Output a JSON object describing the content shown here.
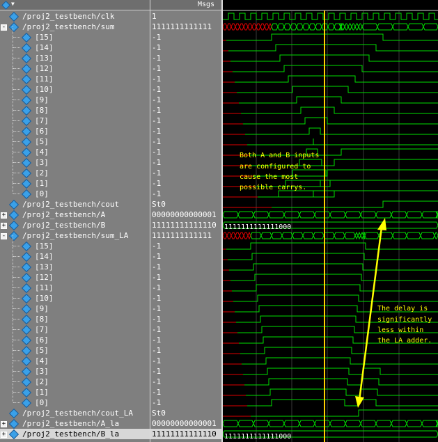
{
  "header": {
    "values_title": "Msgs"
  },
  "signals": [
    {
      "name": "/proj2_testbench/clk",
      "value": "1",
      "level": 0,
      "expander": ""
    },
    {
      "name": "/proj2_testbench/sum",
      "value": "1111111111111",
      "level": 0,
      "expander": "-"
    },
    {
      "name": "[15]",
      "value": "-1",
      "level": 1,
      "expander": ""
    },
    {
      "name": "[14]",
      "value": "-1",
      "level": 1,
      "expander": ""
    },
    {
      "name": "[13]",
      "value": "-1",
      "level": 1,
      "expander": ""
    },
    {
      "name": "[12]",
      "value": "-1",
      "level": 1,
      "expander": ""
    },
    {
      "name": "[11]",
      "value": "-1",
      "level": 1,
      "expander": ""
    },
    {
      "name": "[10]",
      "value": "-1",
      "level": 1,
      "expander": ""
    },
    {
      "name": "[9]",
      "value": "-1",
      "level": 1,
      "expander": ""
    },
    {
      "name": "[8]",
      "value": "-1",
      "level": 1,
      "expander": ""
    },
    {
      "name": "[7]",
      "value": "-1",
      "level": 1,
      "expander": ""
    },
    {
      "name": "[6]",
      "value": "-1",
      "level": 1,
      "expander": ""
    },
    {
      "name": "[5]",
      "value": "-1",
      "level": 1,
      "expander": ""
    },
    {
      "name": "[4]",
      "value": "-1",
      "level": 1,
      "expander": ""
    },
    {
      "name": "[3]",
      "value": "-1",
      "level": 1,
      "expander": ""
    },
    {
      "name": "[2]",
      "value": "-1",
      "level": 1,
      "expander": ""
    },
    {
      "name": "[1]",
      "value": "-1",
      "level": 1,
      "expander": ""
    },
    {
      "name": "[0]",
      "value": "-1",
      "level": 1,
      "expander": ""
    },
    {
      "name": "/proj2_testbench/cout",
      "value": "St0",
      "level": 0,
      "expander": ""
    },
    {
      "name": "/proj2_testbench/A",
      "value": "00000000000001",
      "level": 0,
      "expander": "+"
    },
    {
      "name": "/proj2_testbench/B",
      "value": "11111111111110",
      "level": 0,
      "expander": "+"
    },
    {
      "name": "/proj2_testbench/sum_LA",
      "value": "1111111111111",
      "level": 0,
      "expander": "-"
    },
    {
      "name": "[15]",
      "value": "-1",
      "level": 1,
      "expander": ""
    },
    {
      "name": "[14]",
      "value": "-1",
      "level": 1,
      "expander": ""
    },
    {
      "name": "[13]",
      "value": "-1",
      "level": 1,
      "expander": ""
    },
    {
      "name": "[12]",
      "value": "-1",
      "level": 1,
      "expander": ""
    },
    {
      "name": "[11]",
      "value": "-1",
      "level": 1,
      "expander": ""
    },
    {
      "name": "[10]",
      "value": "-1",
      "level": 1,
      "expander": ""
    },
    {
      "name": "[9]",
      "value": "-1",
      "level": 1,
      "expander": ""
    },
    {
      "name": "[8]",
      "value": "-1",
      "level": 1,
      "expander": ""
    },
    {
      "name": "[7]",
      "value": "-1",
      "level": 1,
      "expander": ""
    },
    {
      "name": "[6]",
      "value": "-1",
      "level": 1,
      "expander": ""
    },
    {
      "name": "[5]",
      "value": "-1",
      "level": 1,
      "expander": ""
    },
    {
      "name": "[4]",
      "value": "-1",
      "level": 1,
      "expander": ""
    },
    {
      "name": "[3]",
      "value": "-1",
      "level": 1,
      "expander": ""
    },
    {
      "name": "[2]",
      "value": "-1",
      "level": 1,
      "expander": ""
    },
    {
      "name": "[1]",
      "value": "-1",
      "level": 1,
      "expander": ""
    },
    {
      "name": "[0]",
      "value": "-1",
      "level": 1,
      "expander": ""
    },
    {
      "name": "/proj2_testbench/cout_LA",
      "value": "St0",
      "level": 0,
      "expander": ""
    },
    {
      "name": "/proj2_testbench/A_la",
      "value": "00000000000001",
      "level": 0,
      "expander": "+"
    },
    {
      "name": "/proj2_testbench/B_la",
      "value": "11111111111110",
      "level": 0,
      "expander": "+",
      "selected": true
    }
  ],
  "bus_labels": {
    "B": "1111111111111000",
    "B_la": "1111111111111000"
  },
  "annotations": {
    "note1": [
      "Both A and B inputs",
      "are configured to",
      "cause the most",
      "possible carrys."
    ],
    "note2": [
      "The delay is",
      "significantly",
      "less within",
      "the LA adder."
    ]
  },
  "colors": {
    "wave_green": "#00e000",
    "wave_red": "#e00000",
    "cursor_yellow": "#ffd000",
    "annotation_yellow": "#ffff00",
    "panel_gray": "#7f7f7f",
    "wave_bg": "#000000"
  },
  "toolbar": {
    "icon": "signal-diamond-icon",
    "dropdown": "chevron-down-icon"
  }
}
